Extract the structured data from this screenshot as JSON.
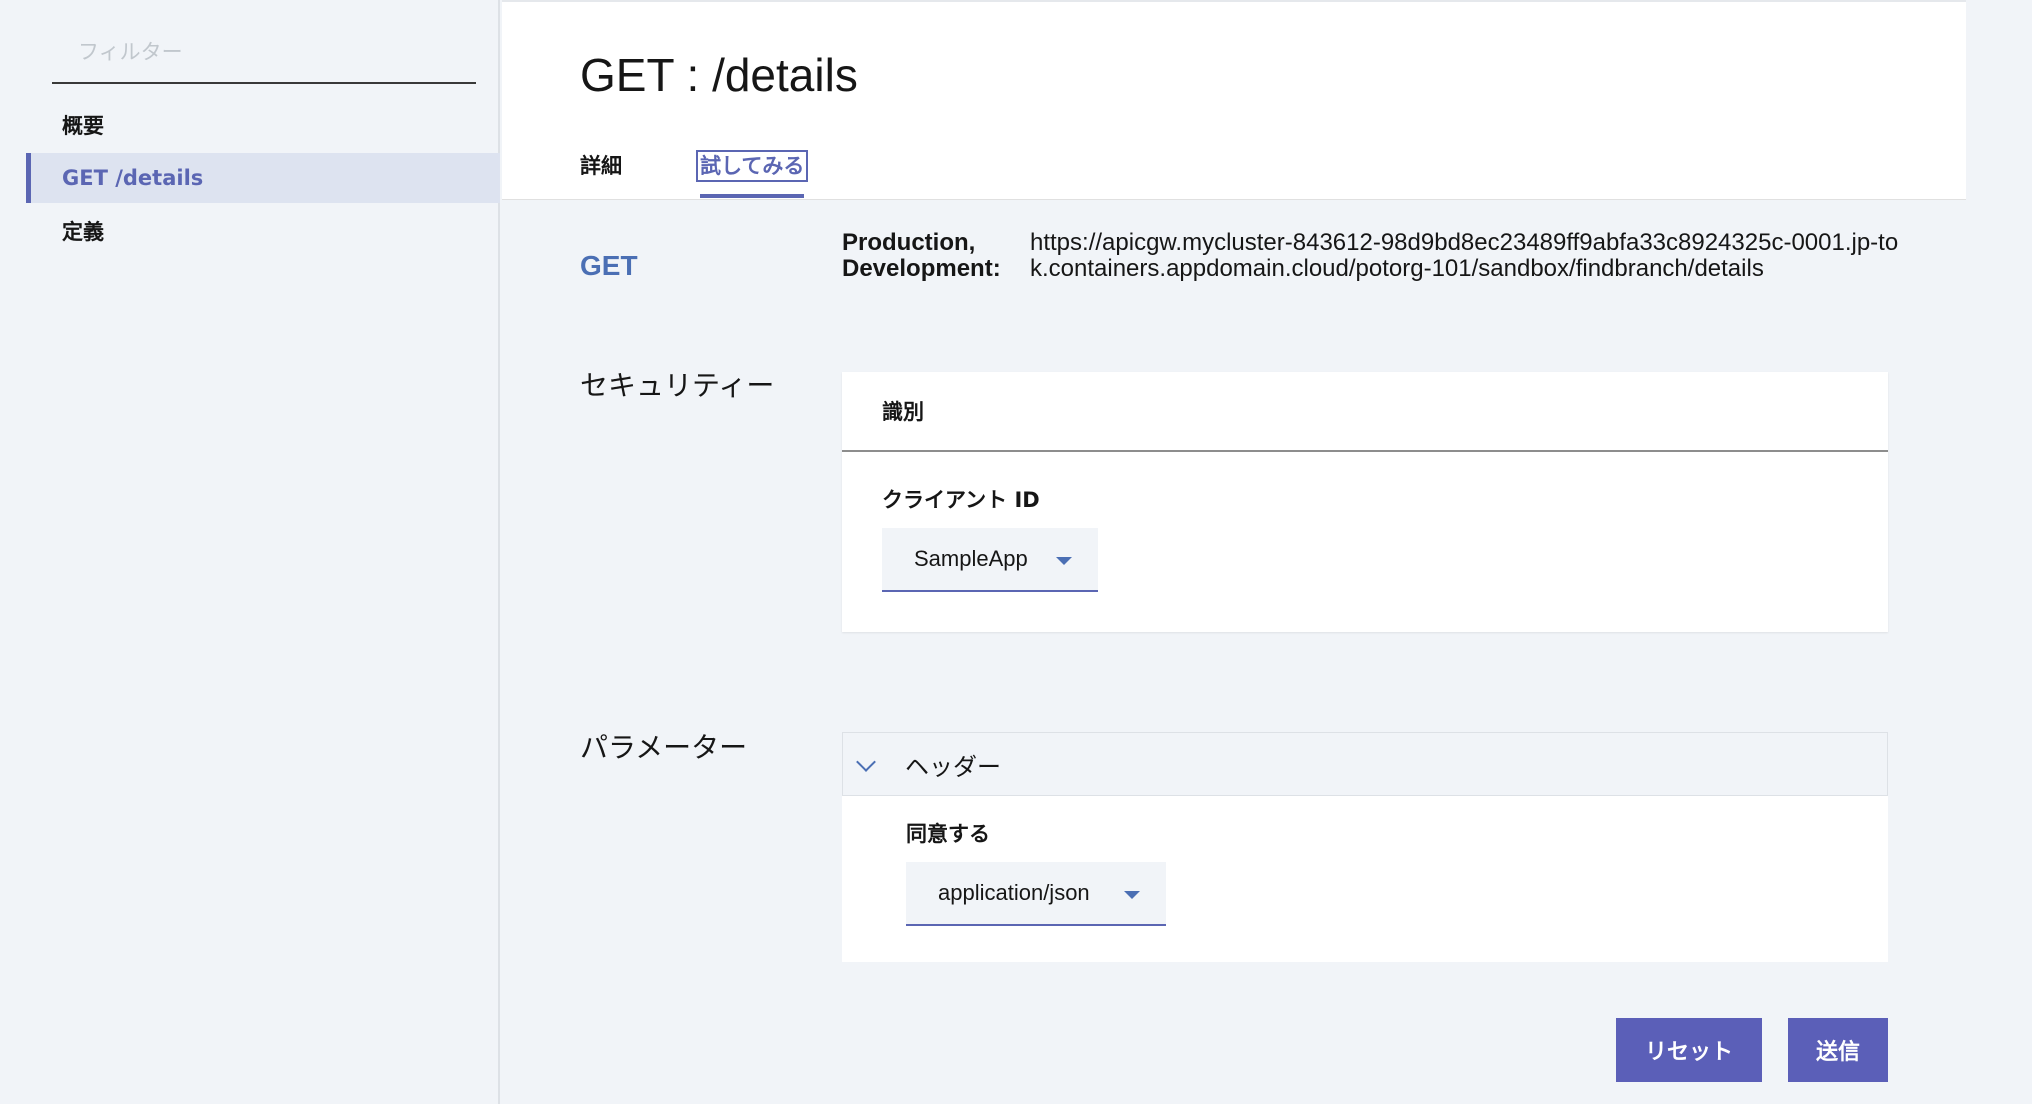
{
  "sidebar": {
    "filter_placeholder": "フィルター",
    "items": [
      {
        "label": "概要"
      },
      {
        "label": "GET /details"
      },
      {
        "label": "定義"
      }
    ]
  },
  "header": {
    "title": "GET : /details",
    "tabs": [
      {
        "label": "詳細"
      },
      {
        "label": "試してみる"
      }
    ]
  },
  "endpoint": {
    "method": "GET",
    "environments": "Production, Development:",
    "url": "https://apicgw.mycluster-843612-98d9bd8ec23489ff9abfa33c8924325c-0001.jp-tok.containers.appdomain.cloud/potorg-101/sandbox/findbranch/details"
  },
  "security": {
    "section_label": "セキュリティー",
    "card_title": "識別",
    "client_id_label": "クライアント ID",
    "client_id_value": "SampleApp"
  },
  "parameters": {
    "section_label": "パラメーター",
    "accordion_title": "ヘッダー",
    "accept_label": "同意する",
    "accept_value": "application/json"
  },
  "actions": {
    "reset_label": "リセット",
    "send_label": "送信"
  },
  "colors": {
    "accent": "#5b66b3",
    "method": "#4b6fb4",
    "button": "#5b5fb8",
    "background": "#f1f4f8"
  }
}
